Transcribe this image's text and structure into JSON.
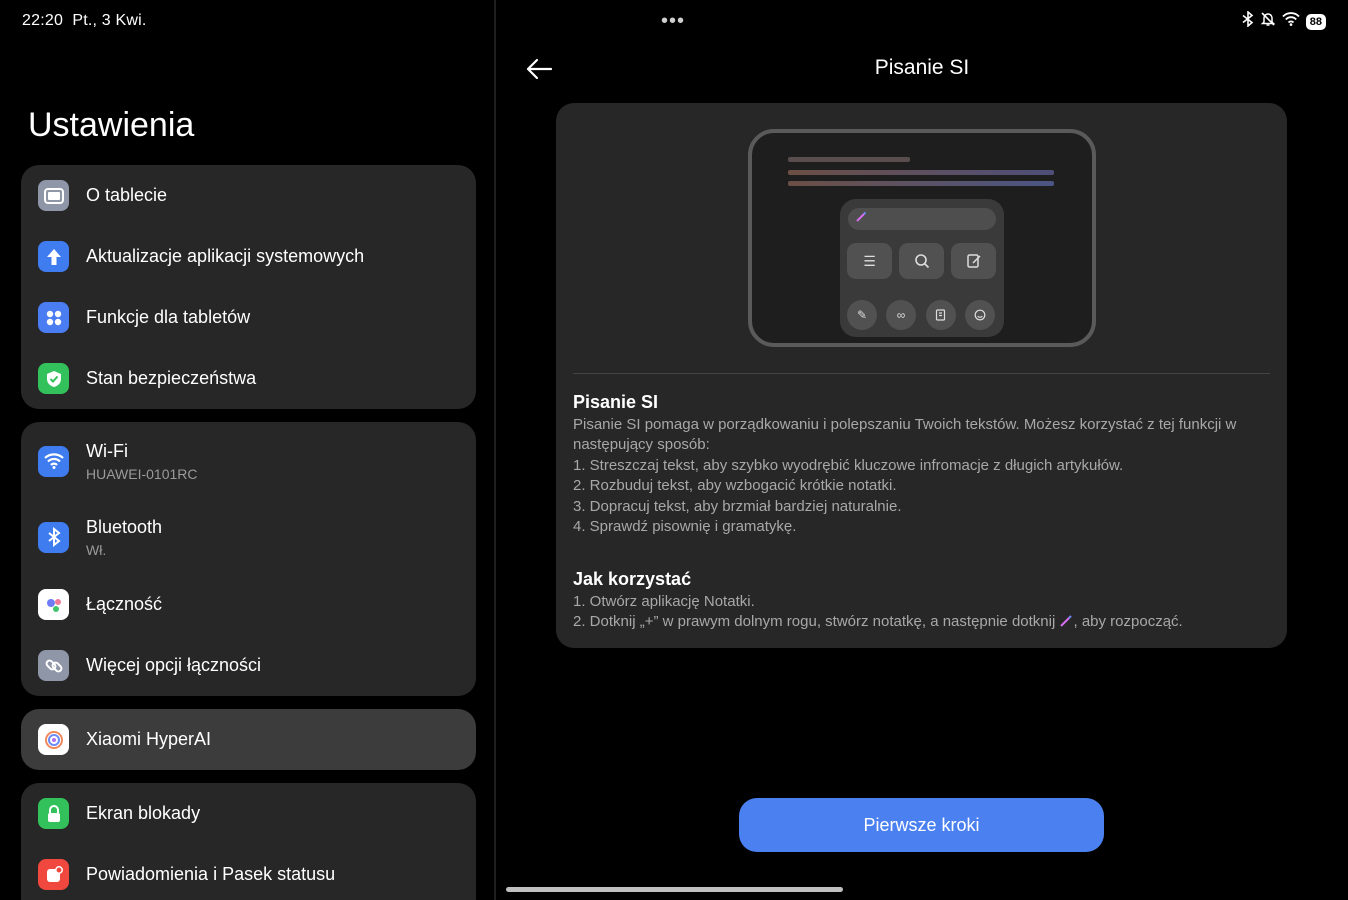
{
  "status_bar": {
    "time": "22:20",
    "date": "Pt., 3 Kwi.",
    "battery": "88",
    "icons": [
      "bluetooth-icon",
      "bell-off-icon",
      "wifi-icon",
      "battery-icon"
    ]
  },
  "settings": {
    "title": "Ustawienia",
    "groups": [
      [
        {
          "label": "O tablecie",
          "icon": "tablet-icon",
          "color": "#8e96a8"
        },
        {
          "label": "Aktualizacje aplikacji systemowych",
          "icon": "upload-arrow-icon",
          "color": "#3f7cf0"
        },
        {
          "label": "Funkcje dla tabletów",
          "icon": "grid-dots-icon",
          "color": "#4a7cf2"
        },
        {
          "label": "Stan bezpieczeństwa",
          "icon": "shield-check-icon",
          "color": "#32c15a"
        }
      ],
      [
        {
          "label": "Wi-Fi",
          "sub": "HUAWEI-0101RC",
          "icon": "wifi-icon",
          "color": "#3f7cf0"
        },
        {
          "label": "Bluetooth",
          "sub": "Wł.",
          "icon": "bluetooth-icon",
          "color": "#3f7cf0"
        },
        {
          "label": "Łączność",
          "icon": "connectivity-dots-icon",
          "color": "#ffffff"
        },
        {
          "label": "Więcej opcji łączności",
          "icon": "link-icon",
          "color": "#8e96a8"
        }
      ],
      [
        {
          "label": "Xiaomi HyperAI",
          "icon": "hyperai-swirl-icon",
          "color": "#ffffff"
        }
      ],
      [
        {
          "label": "Ekran blokady",
          "icon": "lock-icon",
          "color": "#32c15a"
        },
        {
          "label": "Powiadomienia i Pasek statusu",
          "icon": "notification-icon",
          "color": "#f0483e"
        }
      ]
    ]
  },
  "detail": {
    "title": "Pisanie SI",
    "section1_title": "Pisanie SI",
    "section1_lines": [
      "Pisanie SI pomaga w porządkowaniu i polepszaniu Twoich tekstów. Możesz korzystać z tej funkcji w",
      "następujący sposób:",
      "1. Streszczaj tekst, aby szybko wyodrębić kluczowe infromacje z długich artykułów.",
      "2. Rozbuduj tekst, aby wzbogacić krótkie notatki.",
      "3. Dopracuj tekst, aby brzmiał bardziej naturalnie.",
      "4. Sprawdź pisownię i gramatykę."
    ],
    "section2_title": "Jak korzystać",
    "section2_line1": "1. Otwórz aplikację Notatki.",
    "section2_line2_a": "2. Dotknij „+” w prawym dolnym rogu, stwórz notatkę, a następnie dotknij",
    "section2_line2_b": ", aby rozpocząć.",
    "button": "Pierwsze kroki"
  }
}
